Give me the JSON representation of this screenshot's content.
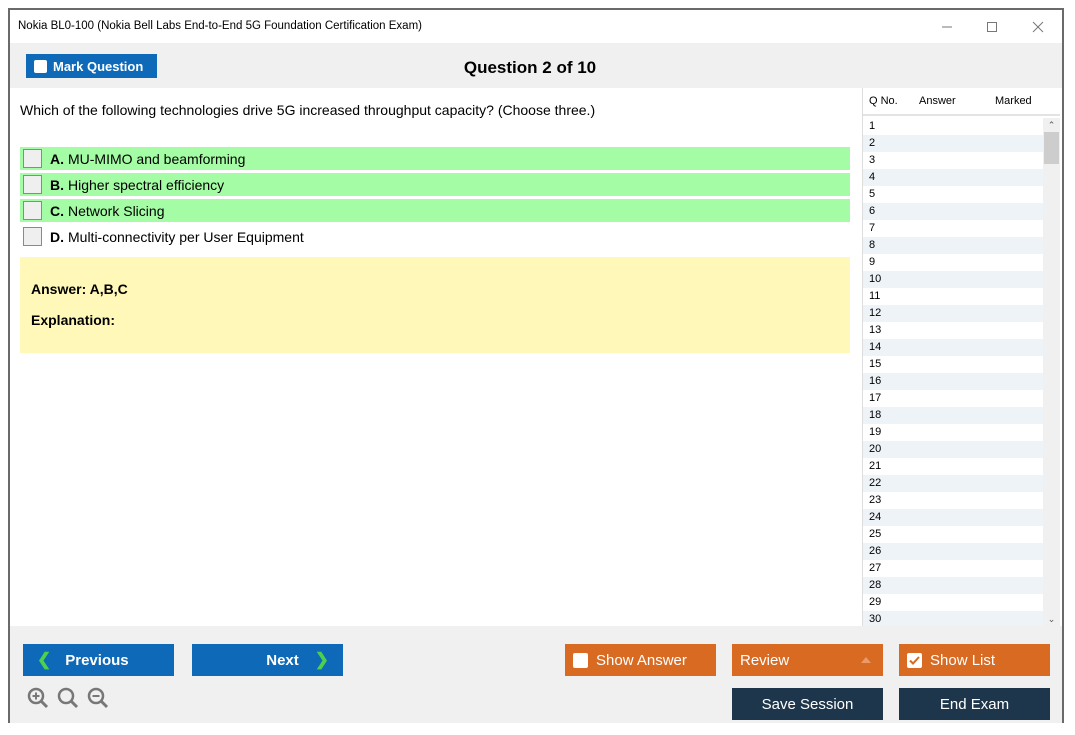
{
  "window": {
    "title": "Nokia BL0-100 (Nokia Bell Labs End-to-End 5G Foundation Certification Exam)",
    "controls": [
      "minimize-icon",
      "maximize-icon",
      "close-icon"
    ]
  },
  "toolbar": {
    "mark_question_label": "Mark Question",
    "question_counter": "Question 2 of 10"
  },
  "question": {
    "text": "Which of the following technologies drive 5G increased throughput capacity? (Choose three.)",
    "options": [
      {
        "letter": "A.",
        "text": "MU-MIMO and beamforming",
        "correct": true
      },
      {
        "letter": "B.",
        "text": "Higher spectral efficiency",
        "correct": true
      },
      {
        "letter": "C.",
        "text": "Network Slicing",
        "correct": true
      },
      {
        "letter": "D.",
        "text": "Multi-connectivity per User Equipment",
        "correct": false
      }
    ],
    "answer_label": "Answer: A,B,C",
    "explanation_label": "Explanation:"
  },
  "question_list": {
    "headers": {
      "qno": "Q No.",
      "answer": "Answer",
      "marked": "Marked"
    },
    "rows": [
      "1",
      "2",
      "3",
      "4",
      "5",
      "6",
      "7",
      "8",
      "9",
      "10",
      "11",
      "12",
      "13",
      "14",
      "15",
      "16",
      "17",
      "18",
      "19",
      "20",
      "21",
      "22",
      "23",
      "24",
      "25",
      "26",
      "27",
      "28",
      "29",
      "30"
    ]
  },
  "footer": {
    "previous_label": "Previous",
    "next_label": "Next",
    "show_answer_label": "Show Answer",
    "review_label": "Review",
    "show_list_label": "Show List",
    "show_list_checked": true,
    "save_session_label": "Save Session",
    "end_exam_label": "End Exam",
    "zoom_icons": [
      "zoom-in-icon",
      "zoom-reset-icon",
      "zoom-out-icon"
    ]
  },
  "colors": {
    "primary_blue": "#0e6ab8",
    "orange": "#d86a22",
    "dark_navy": "#1e364b",
    "correct_green": "#a4fca4",
    "answer_yellow": "#fff8b8"
  }
}
